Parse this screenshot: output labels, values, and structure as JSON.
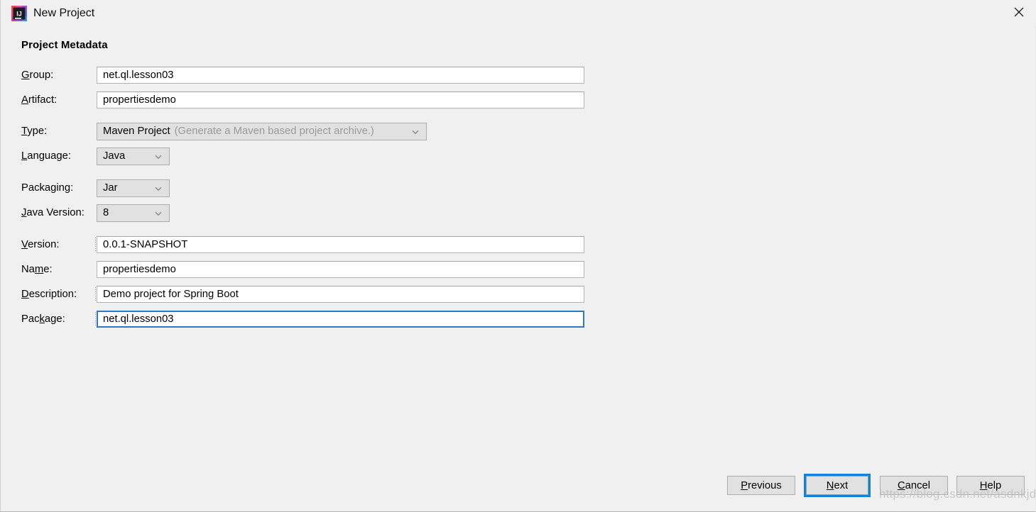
{
  "window": {
    "title": "New Project",
    "app_icon": "intellij-idea-icon",
    "close_icon": "close-icon"
  },
  "section": {
    "title": "Project Metadata"
  },
  "fields": {
    "group": {
      "label_pre": "",
      "label_mnemonic": "G",
      "label_post": "roup:",
      "value": "net.ql.lesson03",
      "focused": false
    },
    "artifact": {
      "label_pre": "",
      "label_mnemonic": "A",
      "label_post": "rtifact:",
      "value": "propertiesdemo",
      "focused": false
    },
    "version": {
      "label_pre": "",
      "label_mnemonic": "V",
      "label_post": "ersion:",
      "value": "0.0.1-SNAPSHOT",
      "focused": false
    },
    "name": {
      "label_pre": "Na",
      "label_mnemonic": "m",
      "label_post": "e:",
      "value": "propertiesdemo",
      "focused": false
    },
    "description": {
      "label_pre": "",
      "label_mnemonic": "D",
      "label_post": "escription:",
      "value": "Demo project for Spring Boot",
      "focused": false
    },
    "package": {
      "label_pre": "Pac",
      "label_mnemonic": "k",
      "label_post": "age:",
      "value": "net.ql.lesson03",
      "focused": true
    }
  },
  "combos": {
    "type": {
      "label_pre": "",
      "label_mnemonic": "T",
      "label_post": "ype:",
      "value": "Maven Project",
      "hint": "(Generate a Maven based project archive.)"
    },
    "language": {
      "label_pre": "",
      "label_mnemonic": "L",
      "label_post": "anguage:",
      "value": "Java",
      "hint": ""
    },
    "packaging": {
      "label_pre": "Packa",
      "label_mnemonic": "g",
      "label_post": "ing:",
      "value": "Jar",
      "hint": ""
    },
    "javaver": {
      "label_pre": "",
      "label_mnemonic": "J",
      "label_post": "ava Version:",
      "value": "8",
      "hint": ""
    }
  },
  "footer": {
    "previous": {
      "pre": "",
      "mnemonic": "P",
      "post": "revious"
    },
    "next": {
      "pre": "",
      "mnemonic": "N",
      "post": "ext"
    },
    "cancel": {
      "pre": "",
      "mnemonic": "C",
      "post": "ancel"
    },
    "help": {
      "pre": "",
      "mnemonic": "H",
      "post": "elp"
    }
  },
  "watermark": "https://blog.csdn.net/asdnkjdk",
  "colors": {
    "background": "#f0f0f0",
    "focus_blue": "#2b79c8",
    "button_focus_blue": "#1184d8",
    "field_white": "#ffffff",
    "control_gray": "#e1e1e1",
    "hint_gray": "#9a9a9a"
  }
}
